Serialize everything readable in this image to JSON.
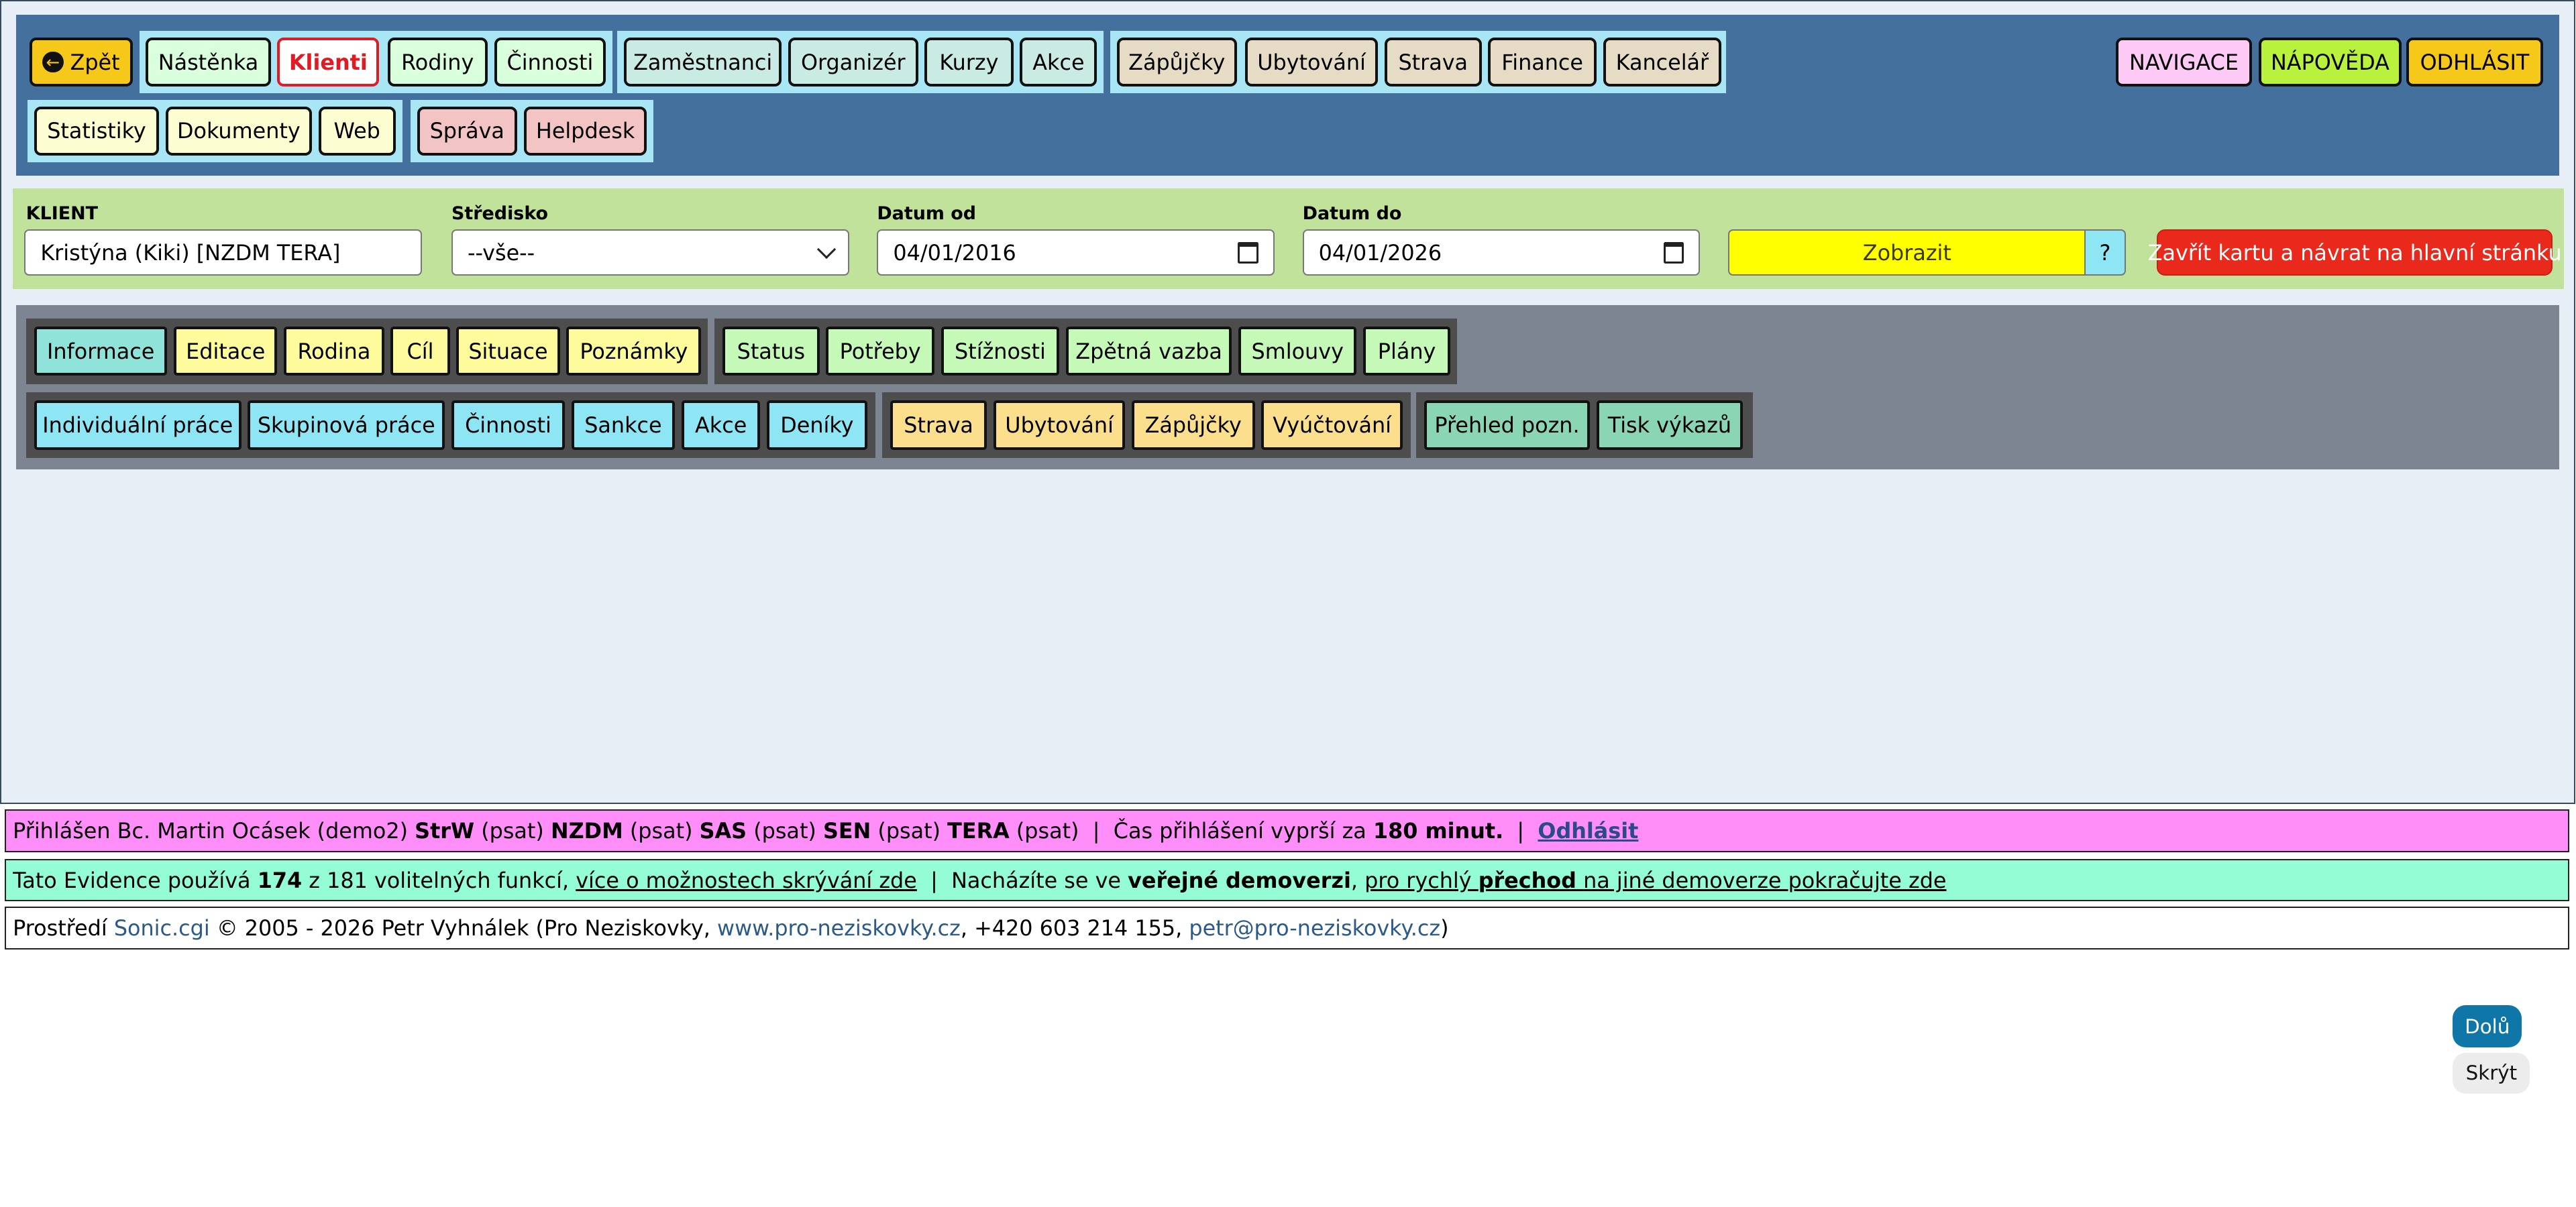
{
  "nav": {
    "back": "Zpět",
    "group1": [
      "Nástěnka",
      "Klienti",
      "Rodiny",
      "Činnosti"
    ],
    "group2": [
      "Zaměstnanci",
      "Organizér",
      "Kurzy",
      "Akce"
    ],
    "group3": [
      "Zápůjčky",
      "Ubytování",
      "Strava",
      "Finance",
      "Kancelář"
    ],
    "right": [
      "NAVIGACE",
      "NÁPOVĚDA",
      "ODHLÁSIT"
    ],
    "row2_group1": [
      "Statistiky",
      "Dokumenty",
      "Web"
    ],
    "row2_group2": [
      "Správa",
      "Helpdesk"
    ]
  },
  "filter": {
    "client_label": "KLIENT",
    "client_value": "Kristýna (Kiki) [NZDM TERA]",
    "center_label": "Středisko",
    "center_value": "--vše--",
    "date_from_label": "Datum od",
    "date_from_value": "04/01/2016",
    "date_to_label": "Datum do",
    "date_to_value": "04/01/2026",
    "show_button": "Zobrazit",
    "help_button": "?",
    "close_button": "Zavřít kartu a návrat na hlavní stránku"
  },
  "subnav": {
    "group1": [
      "Informace",
      "Editace",
      "Rodina",
      "Cíl",
      "Situace",
      "Poznámky"
    ],
    "group2": [
      "Status",
      "Potřeby",
      "Stížnosti",
      "Zpětná vazba",
      "Smlouvy",
      "Plány"
    ],
    "group3": [
      "Individuální práce",
      "Skupinová práce",
      "Činnosti",
      "Sankce",
      "Akce",
      "Deníky"
    ],
    "group4": [
      "Strava",
      "Ubytování",
      "Zápůjčky",
      "Vyúčtování"
    ],
    "group5": [
      "Přehled pozn.",
      "Tisk výkazů"
    ]
  },
  "login_bar": {
    "prefix": "Přihlášen Bc. Martin Ocásek (demo2)",
    "roles": [
      {
        "code": "StrW",
        "type": "(psat)"
      },
      {
        "code": "NZDM",
        "type": "(psat)"
      },
      {
        "code": "SAS",
        "type": "(psat)"
      },
      {
        "code": "SEN",
        "type": "(psat)"
      },
      {
        "code": "TERA",
        "type": "(psat)"
      }
    ],
    "sep": "|",
    "expire_text": "Čas přihlášení vyprší za",
    "expire_value": "180 minut.",
    "logout": "Odhlásit"
  },
  "features_bar": {
    "t1": "Tato Evidence používá",
    "used": "174",
    "t2": "z 181 volitelných funkcí,",
    "link1": "více o možnostech skrývání zde",
    "sep": "|",
    "t3": "Nacházíte se ve",
    "public_demo": "veřejné demoverzi",
    "comma": ",",
    "link2a": "pro rychlý",
    "link2b": "přechod",
    "link2c": "na jiné demoverze pokračujte zde"
  },
  "footer_bar": {
    "t1": "Prostředí",
    "sonic": "Sonic.cgi",
    "t2": "© 2005 - 2026 Petr Vyhnálek (Pro Neziskovky,",
    "web": "www.pro-neziskovky.cz",
    "t3": ", +420 603 214 155,",
    "email": "petr@pro-neziskovky.cz",
    "t4": ")"
  },
  "floating": {
    "down": "Dolů",
    "hide": "Skrýt"
  },
  "colors": {
    "nav_bg": "#44709e",
    "filter_bg": "#c1e29a",
    "subnav_bg": "#7e8592",
    "login_bar_bg": "#ff8ef8",
    "features_bar_bg": "#95fdd5",
    "active_tab_text": "#e01b24",
    "show_button": "#ffff00",
    "close_button": "#e8291c"
  }
}
